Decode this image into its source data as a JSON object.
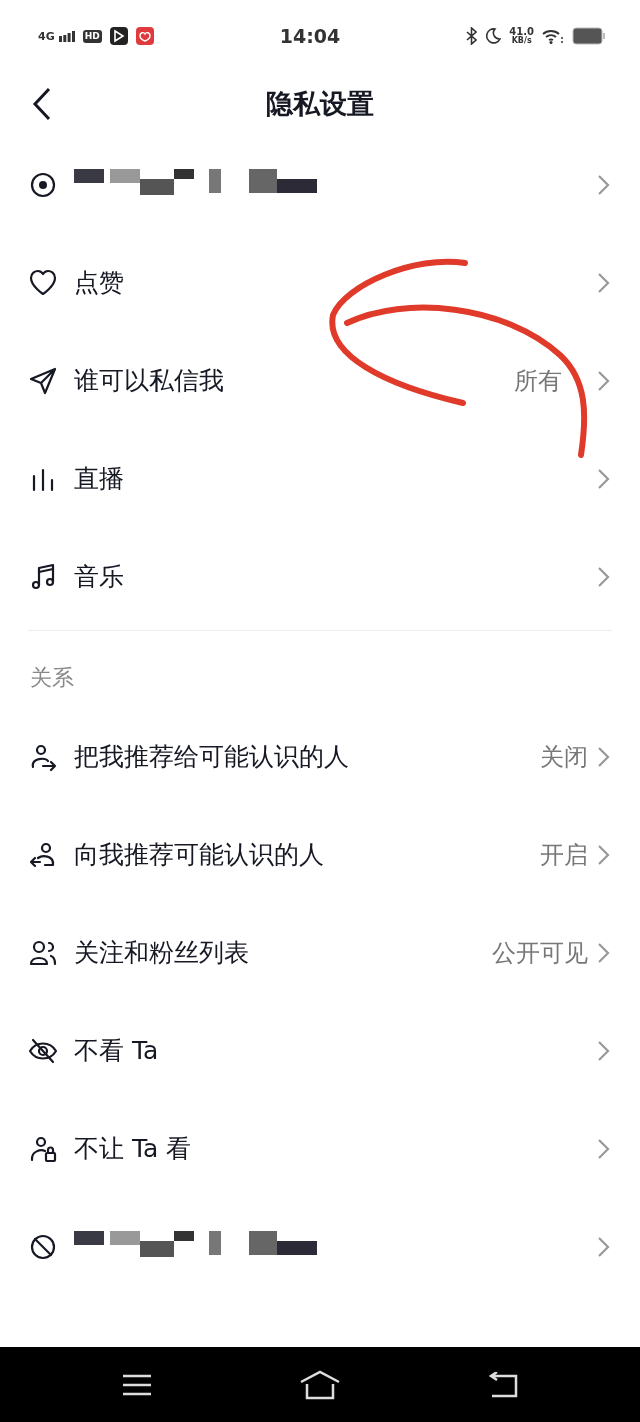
{
  "status_bar": {
    "network": "4G",
    "hd": "HD",
    "time": "14:04",
    "speed": "41.0",
    "speed_unit": "KB/s"
  },
  "header": {
    "title": "隐私设置"
  },
  "sections": [
    {
      "items": [
        {
          "kind": "censored"
        },
        {
          "kind": "item",
          "label": "点赞"
        },
        {
          "kind": "item",
          "label": "谁可以私信我",
          "value": "所有"
        },
        {
          "kind": "item",
          "label": "直播"
        },
        {
          "kind": "item",
          "label": "音乐"
        }
      ]
    },
    {
      "title": "关系",
      "items": [
        {
          "kind": "item",
          "label": "把我推荐给可能认识的人",
          "value": "关闭"
        },
        {
          "kind": "item",
          "label": "向我推荐可能认识的人",
          "value": "开启"
        },
        {
          "kind": "item",
          "label": "关注和粉丝列表",
          "value": "公开可见"
        },
        {
          "kind": "item",
          "label": "不看 Ta"
        },
        {
          "kind": "item",
          "label": "不让 Ta 看"
        },
        {
          "kind": "censored"
        }
      ]
    }
  ]
}
